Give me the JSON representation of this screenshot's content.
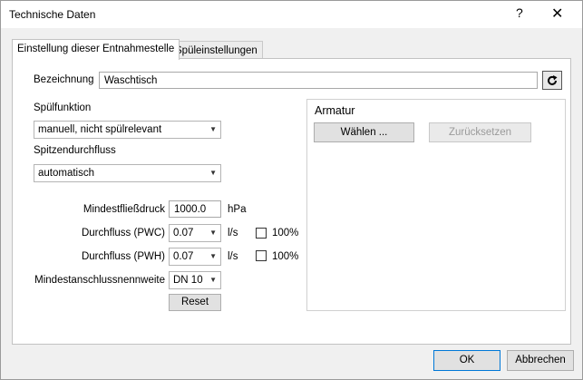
{
  "window": {
    "title": "Technische Daten",
    "help_glyph": "?",
    "close_glyph": "✕"
  },
  "tabs": [
    {
      "label": "Einstellung dieser Entnahmestelle",
      "active": true
    },
    {
      "label": "Spüleinstellungen",
      "active": false
    }
  ],
  "form": {
    "bezeichnung_label": "Bezeichnung",
    "bezeichnung_value": "Waschtisch",
    "spuelfunktion_label": "Spülfunktion",
    "spuelfunktion_value": "manuell, nicht spülrelevant",
    "spitzendurchfluss_label": "Spitzendurchfluss",
    "spitzendurchfluss_value": "automatisch",
    "mindestfliessdruck_label": "Mindestfließdruck",
    "mindestfliessdruck_value": "1000.0",
    "mindestfliessdruck_unit": "hPa",
    "durchfluss_pwc_label": "Durchfluss (PWC)",
    "durchfluss_pwc_value": "0.07",
    "durchfluss_pwc_unit": "l/s",
    "durchfluss_pwc_checkbox_label": "100%",
    "durchfluss_pwh_label": "Durchfluss (PWH)",
    "durchfluss_pwh_value": "0.07",
    "durchfluss_pwh_unit": "l/s",
    "durchfluss_pwh_checkbox_label": "100%",
    "mindestanschluss_label": "Mindestanschlussnennweite",
    "mindestanschluss_value": "DN 10",
    "reset_label": "Reset"
  },
  "armatur": {
    "title": "Armatur",
    "waehlen_label": "Wählen ...",
    "zuruecksetzen_label": "Zurücksetzen"
  },
  "footer": {
    "ok_label": "OK",
    "cancel_label": "Abbrechen"
  },
  "icons": {
    "refresh": "refresh-icon",
    "dropdown": "chevron-down-icon"
  }
}
